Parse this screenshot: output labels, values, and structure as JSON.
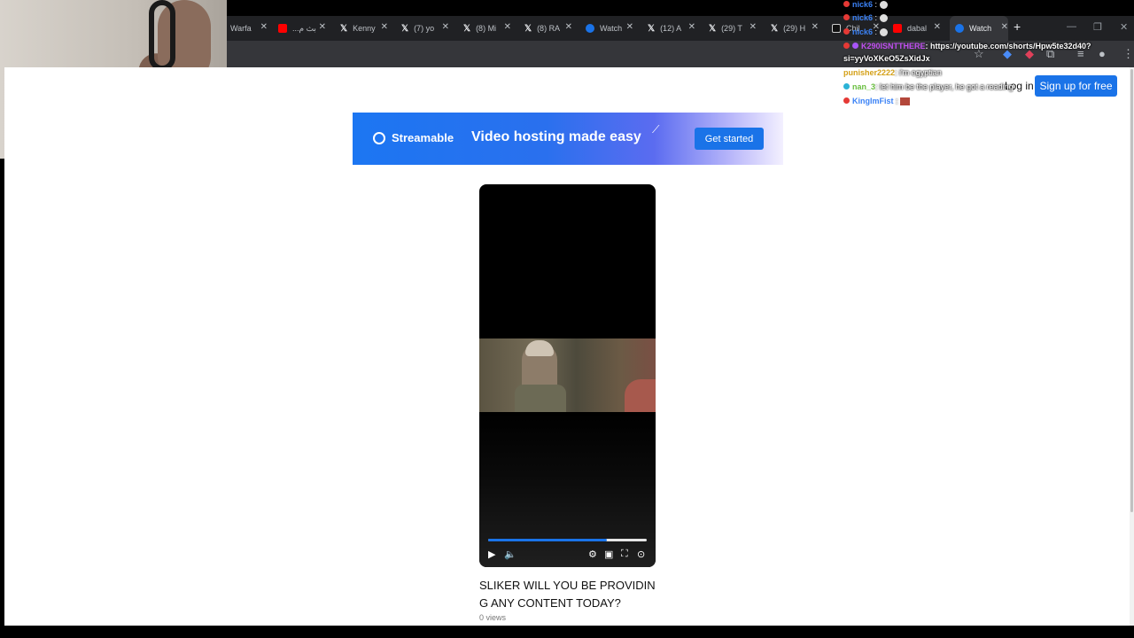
{
  "tabs": [
    {
      "label": "Warfa",
      "icon": "none"
    },
    {
      "label": "...بث م",
      "icon": "youtube-icon"
    },
    {
      "label": "Kenny",
      "icon": "x-icon"
    },
    {
      "label": "(7) yo",
      "icon": "x-icon"
    },
    {
      "label": "(8) Mi",
      "icon": "x-icon"
    },
    {
      "label": "(8) RA",
      "icon": "x-icon"
    },
    {
      "label": "Watch",
      "icon": "streamable-icon"
    },
    {
      "label": "(12) A",
      "icon": "x-icon"
    },
    {
      "label": "(29) T",
      "icon": "x-icon"
    },
    {
      "label": "(29) H",
      "icon": "x-icon"
    },
    {
      "label": "Chil",
      "icon": "tiktok-icon"
    },
    {
      "label": "dabal",
      "icon": "youtube-icon"
    },
    {
      "label": "Watch",
      "icon": "streamable-icon",
      "active": true
    }
  ],
  "header": {
    "login_label": "Log in",
    "signup_label": "Sign up for free"
  },
  "banner": {
    "logo_text": "Streamable",
    "tagline": "Video hosting made easy",
    "cta_label": "Get started"
  },
  "video": {
    "title": "SLIKER WILL YOU BE PROVIDING ANY CONTENT TODAY?",
    "views": "0 views",
    "progress": 0.75
  },
  "chat": [
    {
      "user": "nick6",
      "color": "#3b82f6",
      "message": ":",
      "emote": true
    },
    {
      "user": "nick6",
      "color": "#3b82f6",
      "message": ":",
      "emote": true
    },
    {
      "user": "nick6",
      "color": "#3b82f6",
      "message": ":",
      "emote": true
    },
    {
      "user": "K290ISNTTHERE",
      "color": "#c04ef0",
      "message": ": https://youtube.com/shorts/Hpw5te32d40?"
    },
    {
      "user": "",
      "color": "#ffffff",
      "message": "si=yyVoXKeO5ZsXidJx"
    },
    {
      "user": "punisher2222",
      "color": "#d4a017",
      "message": ": i'm egyptian"
    },
    {
      "user": "nan_3",
      "color": "#6abf40",
      "message": ": let him be the player, he got a reading"
    },
    {
      "user": "KingImFist",
      "color": "#3b82f6",
      "message": ":",
      "emote_sq": true
    }
  ],
  "colors": {
    "accent": "#1a73e8",
    "tab_bg": "#202124",
    "toolbar_bg": "#35363a"
  }
}
